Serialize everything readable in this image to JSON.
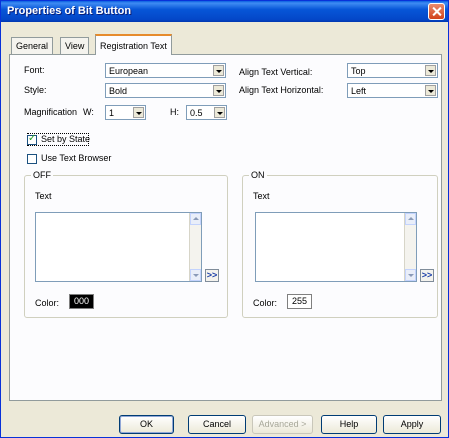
{
  "window": {
    "title": "Properties of Bit Button"
  },
  "tabs": [
    {
      "label": "General"
    },
    {
      "label": "View"
    },
    {
      "label": "Registration Text"
    }
  ],
  "font": {
    "label": "Font:",
    "value": "European"
  },
  "style": {
    "label": "Style:",
    "value": "Bold"
  },
  "magnification": {
    "label": "Magnification",
    "w_label": "W:",
    "w_value": "1",
    "h_label": "H:",
    "h_value": "0.5"
  },
  "align_vertical": {
    "label": "Align Text Vertical:",
    "value": "Top"
  },
  "align_horizontal": {
    "label": "Align Text Horizontal:",
    "value": "Left"
  },
  "set_by_state": {
    "label": "Set by State",
    "checked": true
  },
  "use_text_browser": {
    "label": "Use Text Browser",
    "checked": false
  },
  "off_group": {
    "title": "OFF",
    "text_label": "Text",
    "more": ">>",
    "color_label": "Color:",
    "color_value": "000",
    "color_hex": "#000000"
  },
  "on_group": {
    "title": "ON",
    "text_label": "Text",
    "more": ">>",
    "color_label": "Color:",
    "color_value": "255",
    "color_hex": "#ffffff"
  },
  "buttons": {
    "ok": "OK",
    "cancel": "Cancel",
    "advanced": "Advanced >",
    "help": "Help",
    "apply": "Apply"
  }
}
